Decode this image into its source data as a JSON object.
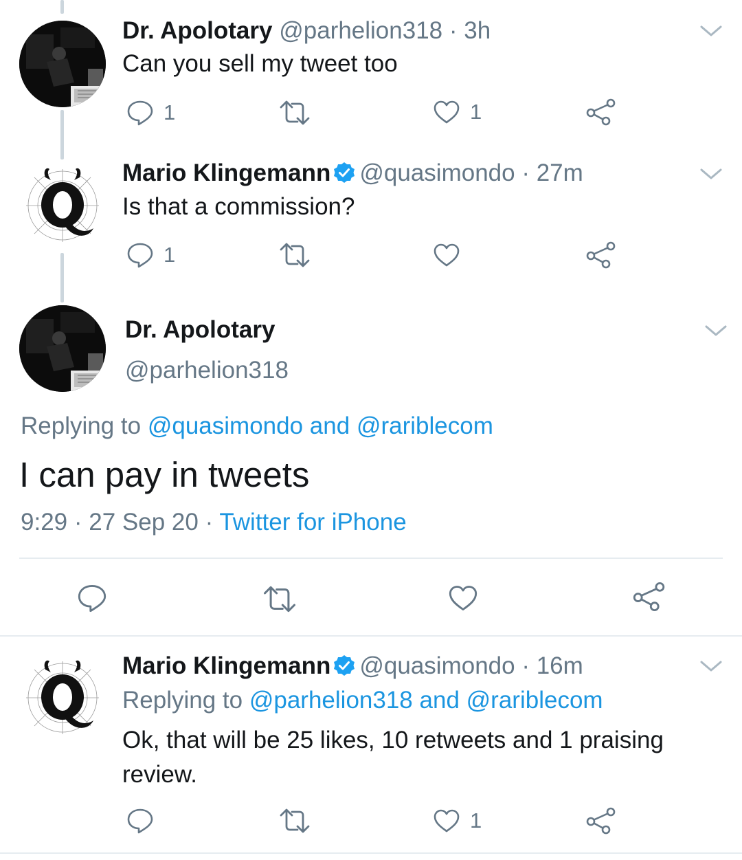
{
  "tweets": [
    {
      "author_name": "Dr. Apolotary",
      "handle": "@parhelion318",
      "separator": "·",
      "time": "3h",
      "text": "Can you sell my tweet too",
      "reply_count": "1",
      "retweet_count": "",
      "like_count": "1"
    },
    {
      "author_name": "Mario Klingemann",
      "handle": "@quasimondo",
      "separator": "·",
      "time": "27m",
      "text": "Is that a commission?",
      "reply_count": "1",
      "retweet_count": "",
      "like_count": ""
    }
  ],
  "focused": {
    "author_name": "Dr. Apolotary",
    "handle": "@parhelion318",
    "replying_prefix": "Replying to",
    "replying_user1": "@quasimondo",
    "replying_and": "and",
    "replying_user2": "@rariblecom",
    "text": "I can pay in tweets",
    "time": "9:29",
    "separator": "·",
    "date": "27 Sep 20",
    "client": "Twitter for iPhone"
  },
  "reply": {
    "author_name": "Mario Klingemann",
    "handle": "@quasimondo",
    "separator": "·",
    "time": "16m",
    "replying_prefix": "Replying to",
    "replying_user1": "@parhelion318",
    "replying_and": "and",
    "replying_user2": "@rariblecom",
    "text": "Ok, that will be 25 likes, 10 retweets and 1 praising review.",
    "reply_count": "",
    "retweet_count": "",
    "like_count": "1"
  },
  "colors": {
    "link": "#1b95e0",
    "muted": "#657786",
    "text": "#14171a",
    "verified": "#1da1f2",
    "divider": "#e6ecf0",
    "thread_line": "#ccd6dd"
  },
  "icons": [
    "reply-icon",
    "retweet-icon",
    "like-icon",
    "share-icon",
    "chevron-down-icon",
    "verified-badge-icon"
  ]
}
